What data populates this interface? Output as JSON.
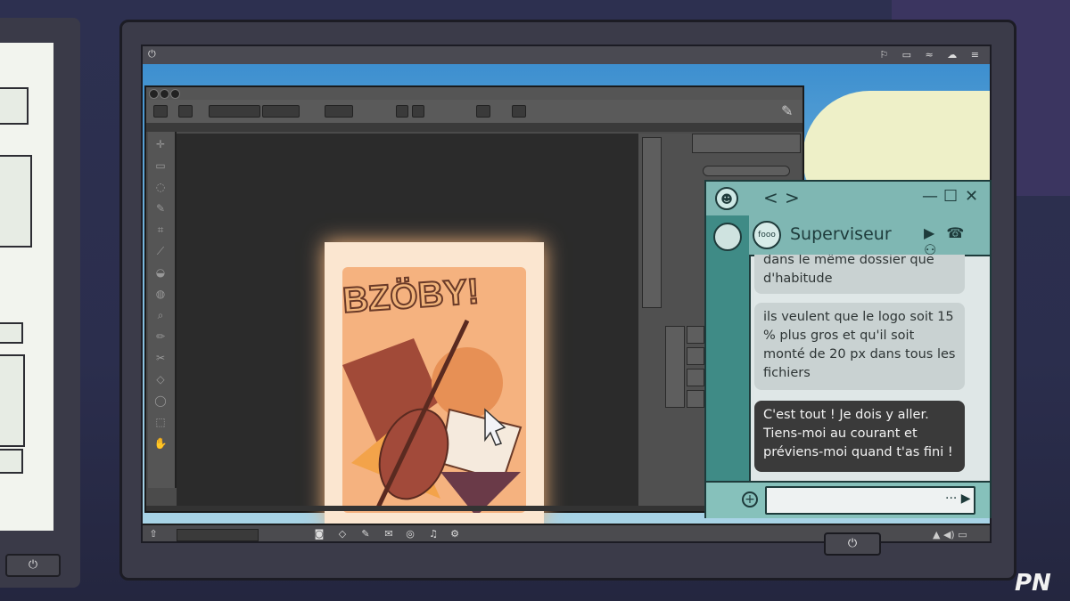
{
  "colors": {
    "chat_accent": "#7fb7b3",
    "chat_sidebar": "#3f8b86",
    "incoming_bubble": "#c9d2d2",
    "outgoing_bubble": "#3a3a3a",
    "editor_bg": "#4b4b4b",
    "artwork_bg": "#f5b27f"
  },
  "monitor": {
    "power_icon": "⏻",
    "tray_icons": "⚐ ▭ ≈ ☁ ≡"
  },
  "editor": {
    "tools_icons": [
      "✛",
      "▭",
      "◌",
      "✎",
      "⌗",
      "⟋",
      "◒",
      "◍",
      "⌕",
      "✏",
      "✂",
      "◇",
      "◯",
      "⬚",
      "✋"
    ],
    "brush_icon": "✎"
  },
  "artwork": {
    "title_text": "BZÖBY!"
  },
  "taskbar": {
    "home_icon": "⇧",
    "tray_text": "▲ ◀) ▭"
  },
  "chat": {
    "nav_back": "<",
    "nav_forward": ">",
    "minimize": "—",
    "maximize": "☐",
    "close": "✕",
    "logo_icon": "☻",
    "contact": {
      "name": "Superviseur",
      "avatar_label": "fooo",
      "call_icons": "▶ ☎ ⚇"
    },
    "messages": [
      {
        "from": "in",
        "text": "dans le même dossier que d'habitude"
      },
      {
        "from": "in",
        "text": "ils veulent que le logo soit 15 % plus gros et qu'il soit monté de 20 px dans tous les fichiers"
      },
      {
        "from": "out",
        "text": "C'est tout ! Je dois y aller. Tiens-moi au courant et préviens-moi quand t'as fini !"
      }
    ],
    "input": {
      "plus_icon": "+",
      "send_icon": "··· ▶"
    }
  },
  "watermark": "PN"
}
